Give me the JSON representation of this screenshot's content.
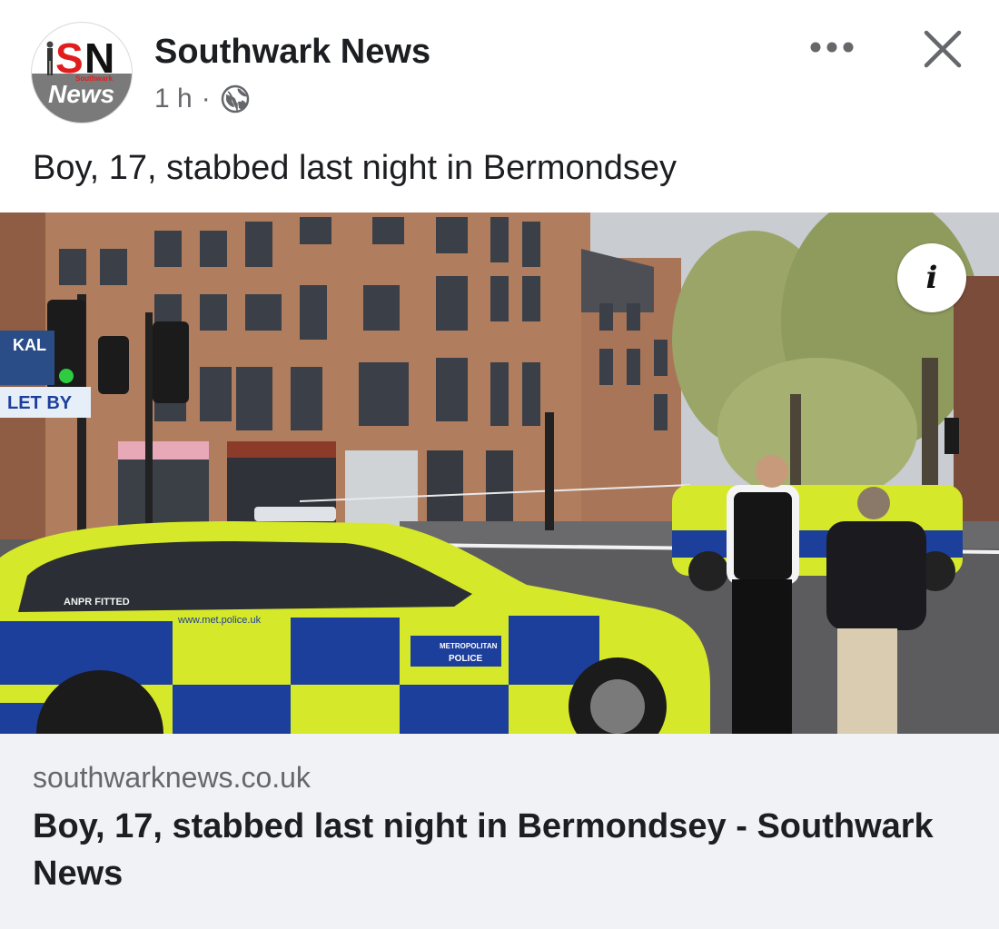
{
  "header": {
    "page_name": "Southwark News",
    "time": "1 h",
    "separator": "·",
    "privacy_icon": "globe-icon",
    "more_icon": "more-horizontal-icon",
    "close_icon": "close-icon"
  },
  "avatar": {
    "logo_letters_left": "S",
    "logo_letters_right": "N",
    "logo_small_text": "Southwark",
    "logo_word": "News"
  },
  "post": {
    "caption": "Boy, 17, stabbed last night in Bermondsey"
  },
  "photo": {
    "info_icon": "info-icon",
    "info_glyph": "i",
    "sign_text_1": "KAL",
    "sign_text_2": "LET BY",
    "car_text_1": "ANPR FITTED",
    "car_text_2": "www.met.police.uk",
    "car_text_3": "METROPOLITAN",
    "car_text_4": "POLICE",
    "colors": {
      "sky": "#c9ccd1",
      "brick": "#b07d5e",
      "police_yellow": "#d6e82a",
      "police_blue": "#1d3f9c",
      "road": "#5c5c5f",
      "trees": "#9aa567"
    }
  },
  "link_preview": {
    "domain": "southwarknews.co.uk",
    "title": "Boy, 17, stabbed last night in Bermondsey - Southwark News"
  }
}
